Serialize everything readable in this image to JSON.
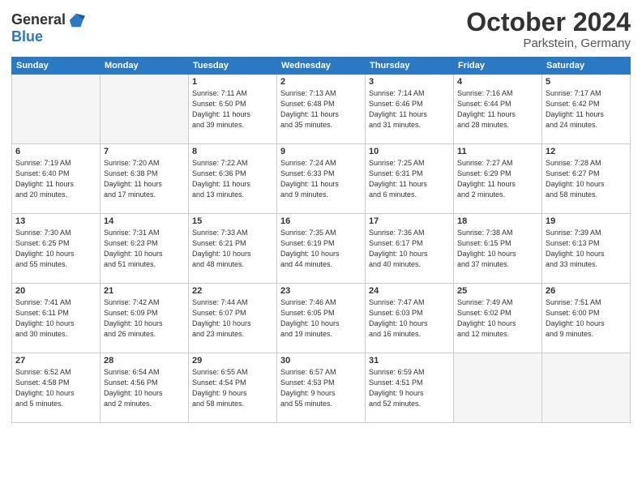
{
  "header": {
    "logo_line1": "General",
    "logo_line2": "Blue",
    "month": "October 2024",
    "location": "Parkstein, Germany"
  },
  "weekdays": [
    "Sunday",
    "Monday",
    "Tuesday",
    "Wednesday",
    "Thursday",
    "Friday",
    "Saturday"
  ],
  "weeks": [
    [
      {
        "day": "",
        "content": ""
      },
      {
        "day": "",
        "content": ""
      },
      {
        "day": "1",
        "content": "Sunrise: 7:11 AM\nSunset: 6:50 PM\nDaylight: 11 hours\nand 39 minutes."
      },
      {
        "day": "2",
        "content": "Sunrise: 7:13 AM\nSunset: 6:48 PM\nDaylight: 11 hours\nand 35 minutes."
      },
      {
        "day": "3",
        "content": "Sunrise: 7:14 AM\nSunset: 6:46 PM\nDaylight: 11 hours\nand 31 minutes."
      },
      {
        "day": "4",
        "content": "Sunrise: 7:16 AM\nSunset: 6:44 PM\nDaylight: 11 hours\nand 28 minutes."
      },
      {
        "day": "5",
        "content": "Sunrise: 7:17 AM\nSunset: 6:42 PM\nDaylight: 11 hours\nand 24 minutes."
      }
    ],
    [
      {
        "day": "6",
        "content": "Sunrise: 7:19 AM\nSunset: 6:40 PM\nDaylight: 11 hours\nand 20 minutes."
      },
      {
        "day": "7",
        "content": "Sunrise: 7:20 AM\nSunset: 6:38 PM\nDaylight: 11 hours\nand 17 minutes."
      },
      {
        "day": "8",
        "content": "Sunrise: 7:22 AM\nSunset: 6:36 PM\nDaylight: 11 hours\nand 13 minutes."
      },
      {
        "day": "9",
        "content": "Sunrise: 7:24 AM\nSunset: 6:33 PM\nDaylight: 11 hours\nand 9 minutes."
      },
      {
        "day": "10",
        "content": "Sunrise: 7:25 AM\nSunset: 6:31 PM\nDaylight: 11 hours\nand 6 minutes."
      },
      {
        "day": "11",
        "content": "Sunrise: 7:27 AM\nSunset: 6:29 PM\nDaylight: 11 hours\nand 2 minutes."
      },
      {
        "day": "12",
        "content": "Sunrise: 7:28 AM\nSunset: 6:27 PM\nDaylight: 10 hours\nand 58 minutes."
      }
    ],
    [
      {
        "day": "13",
        "content": "Sunrise: 7:30 AM\nSunset: 6:25 PM\nDaylight: 10 hours\nand 55 minutes."
      },
      {
        "day": "14",
        "content": "Sunrise: 7:31 AM\nSunset: 6:23 PM\nDaylight: 10 hours\nand 51 minutes."
      },
      {
        "day": "15",
        "content": "Sunrise: 7:33 AM\nSunset: 6:21 PM\nDaylight: 10 hours\nand 48 minutes."
      },
      {
        "day": "16",
        "content": "Sunrise: 7:35 AM\nSunset: 6:19 PM\nDaylight: 10 hours\nand 44 minutes."
      },
      {
        "day": "17",
        "content": "Sunrise: 7:36 AM\nSunset: 6:17 PM\nDaylight: 10 hours\nand 40 minutes."
      },
      {
        "day": "18",
        "content": "Sunrise: 7:38 AM\nSunset: 6:15 PM\nDaylight: 10 hours\nand 37 minutes."
      },
      {
        "day": "19",
        "content": "Sunrise: 7:39 AM\nSunset: 6:13 PM\nDaylight: 10 hours\nand 33 minutes."
      }
    ],
    [
      {
        "day": "20",
        "content": "Sunrise: 7:41 AM\nSunset: 6:11 PM\nDaylight: 10 hours\nand 30 minutes."
      },
      {
        "day": "21",
        "content": "Sunrise: 7:42 AM\nSunset: 6:09 PM\nDaylight: 10 hours\nand 26 minutes."
      },
      {
        "day": "22",
        "content": "Sunrise: 7:44 AM\nSunset: 6:07 PM\nDaylight: 10 hours\nand 23 minutes."
      },
      {
        "day": "23",
        "content": "Sunrise: 7:46 AM\nSunset: 6:05 PM\nDaylight: 10 hours\nand 19 minutes."
      },
      {
        "day": "24",
        "content": "Sunrise: 7:47 AM\nSunset: 6:03 PM\nDaylight: 10 hours\nand 16 minutes."
      },
      {
        "day": "25",
        "content": "Sunrise: 7:49 AM\nSunset: 6:02 PM\nDaylight: 10 hours\nand 12 minutes."
      },
      {
        "day": "26",
        "content": "Sunrise: 7:51 AM\nSunset: 6:00 PM\nDaylight: 10 hours\nand 9 minutes."
      }
    ],
    [
      {
        "day": "27",
        "content": "Sunrise: 6:52 AM\nSunset: 4:58 PM\nDaylight: 10 hours\nand 5 minutes."
      },
      {
        "day": "28",
        "content": "Sunrise: 6:54 AM\nSunset: 4:56 PM\nDaylight: 10 hours\nand 2 minutes."
      },
      {
        "day": "29",
        "content": "Sunrise: 6:55 AM\nSunset: 4:54 PM\nDaylight: 9 hours\nand 58 minutes."
      },
      {
        "day": "30",
        "content": "Sunrise: 6:57 AM\nSunset: 4:53 PM\nDaylight: 9 hours\nand 55 minutes."
      },
      {
        "day": "31",
        "content": "Sunrise: 6:59 AM\nSunset: 4:51 PM\nDaylight: 9 hours\nand 52 minutes."
      },
      {
        "day": "",
        "content": ""
      },
      {
        "day": "",
        "content": ""
      }
    ]
  ]
}
